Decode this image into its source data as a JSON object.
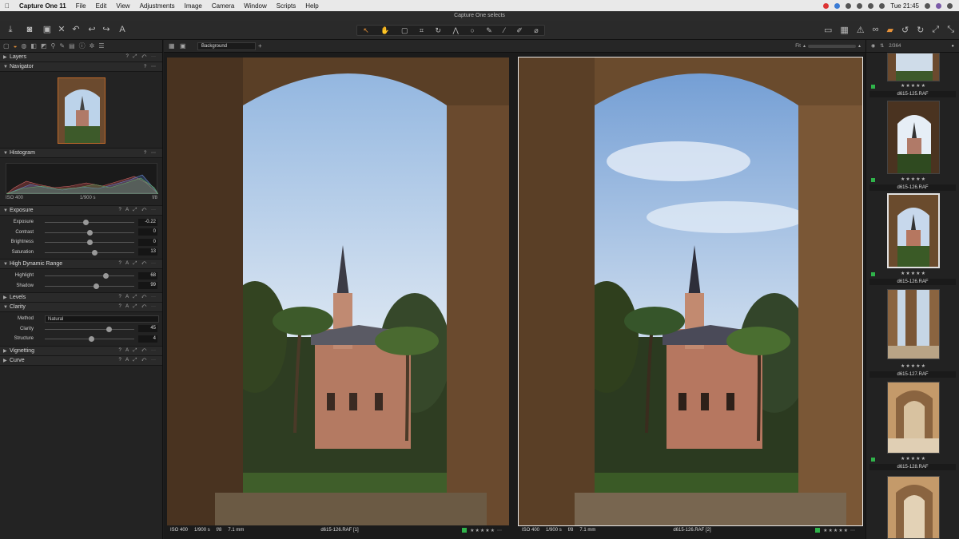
{
  "menubar": {
    "app": "Capture One 11",
    "items": [
      "File",
      "Edit",
      "View",
      "Adjustments",
      "Image",
      "Camera",
      "Window",
      "Scripts",
      "Help"
    ],
    "clock": "Tue 21:45"
  },
  "window": {
    "title": "Capture One selects"
  },
  "left_panel": {
    "layers": "Layers",
    "navigator": "Navigator",
    "histogram": {
      "title": "Histogram",
      "iso": "ISO 400",
      "shutter": "1/900 s",
      "aperture": "f/8"
    },
    "exposure": {
      "title": "Exposure",
      "rows": [
        {
          "label": "Exposure",
          "value": "-0.22",
          "pos": 0.46
        },
        {
          "label": "Contrast",
          "value": "0",
          "pos": 0.5
        },
        {
          "label": "Brightness",
          "value": "0",
          "pos": 0.5
        },
        {
          "label": "Saturation",
          "value": "13",
          "pos": 0.56
        }
      ]
    },
    "hdr": {
      "title": "High Dynamic Range",
      "rows": [
        {
          "label": "Highlight",
          "value": "68",
          "pos": 0.68
        },
        {
          "label": "Shadow",
          "value": "99",
          "pos": 0.58
        }
      ]
    },
    "levels": "Levels",
    "clarity": {
      "title": "Clarity",
      "method_label": "Method",
      "method_value": "Natural",
      "rows": [
        {
          "label": "Clarity",
          "value": "45",
          "pos": 0.72
        },
        {
          "label": "Structure",
          "value": "4",
          "pos": 0.52
        }
      ]
    },
    "vignetting": "Vignetting",
    "curve": "Curve"
  },
  "viewer": {
    "layer_select": "Background",
    "fit_label": "Fit",
    "photos": [
      {
        "iso": "ISO 400",
        "shutter": "1/900 s",
        "aperture": "f/8",
        "focal": "7.1 mm",
        "filename": "d615-126.RAF [1]",
        "stars": "★★★★★"
      },
      {
        "iso": "ISO 400",
        "shutter": "1/900 s",
        "aperture": "f/8",
        "focal": "7.1 mm",
        "filename": "d615-126.RAF [2]",
        "stars": "★★★★★"
      }
    ]
  },
  "browser": {
    "count": "2/364",
    "items": [
      {
        "label": "d615-125.RAF",
        "stars": "★★★★★"
      },
      {
        "label": "d615-126.RAF",
        "stars": "★★★★★"
      },
      {
        "label": "d615-126.RAF",
        "stars": "★★★★★"
      },
      {
        "label": "d615-127.RAF",
        "stars": "★★★★★"
      },
      {
        "label": "d615-128.RAF",
        "stars": "★★★★★"
      }
    ]
  },
  "colors": {
    "accent": "#e6923a",
    "green_tag": "#2fb34a",
    "panel_bg": "#232323"
  },
  "icons": [
    "apple-icon",
    "import-icon",
    "camera-icon",
    "undo-icon",
    "redo-icon",
    "cursor-icon",
    "crop-icon",
    "brush-icon",
    "erase-icon",
    "gear-icon",
    "star-icon",
    "warning-icon",
    "eye-icon"
  ]
}
